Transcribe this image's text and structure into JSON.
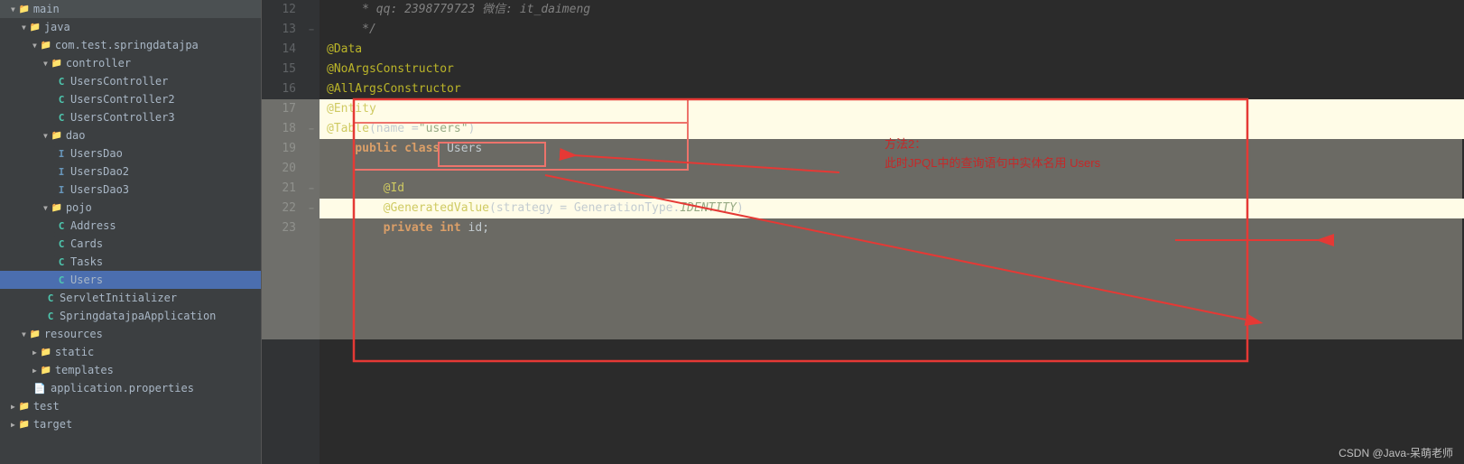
{
  "sidebar": {
    "items": [
      {
        "id": "main",
        "label": "main",
        "level": 0,
        "type": "folder-open",
        "expanded": true
      },
      {
        "id": "java",
        "label": "java",
        "level": 1,
        "type": "folder-open",
        "expanded": true
      },
      {
        "id": "com.test.springdatajpa",
        "label": "com.test.springdatajpa",
        "level": 2,
        "type": "folder-open",
        "expanded": true
      },
      {
        "id": "controller",
        "label": "controller",
        "level": 3,
        "type": "folder-open",
        "expanded": true
      },
      {
        "id": "UsersController",
        "label": "UsersController",
        "level": 4,
        "type": "class"
      },
      {
        "id": "UsersController2",
        "label": "UsersController2",
        "level": 4,
        "type": "class"
      },
      {
        "id": "UsersController3",
        "label": "UsersController3",
        "level": 4,
        "type": "class"
      },
      {
        "id": "dao",
        "label": "dao",
        "level": 3,
        "type": "folder-open",
        "expanded": true
      },
      {
        "id": "UsersDao",
        "label": "UsersDao",
        "level": 4,
        "type": "interface"
      },
      {
        "id": "UsersDao2",
        "label": "UsersDao2",
        "level": 4,
        "type": "interface"
      },
      {
        "id": "UsersDao3",
        "label": "UsersDao3",
        "level": 4,
        "type": "interface"
      },
      {
        "id": "pojo",
        "label": "pojo",
        "level": 3,
        "type": "folder-open",
        "expanded": true
      },
      {
        "id": "Address",
        "label": "Address",
        "level": 4,
        "type": "class"
      },
      {
        "id": "Cards",
        "label": "Cards",
        "level": 4,
        "type": "class"
      },
      {
        "id": "Tasks",
        "label": "Tasks",
        "level": 4,
        "type": "class"
      },
      {
        "id": "Users",
        "label": "Users",
        "level": 4,
        "type": "class",
        "selected": true
      },
      {
        "id": "ServletInitializer",
        "label": "ServletInitializer",
        "level": 3,
        "type": "class"
      },
      {
        "id": "SpringdatajpaApplication",
        "label": "SpringdatajpaApplication",
        "level": 3,
        "type": "class"
      },
      {
        "id": "resources",
        "label": "resources",
        "level": 1,
        "type": "folder-open",
        "expanded": true
      },
      {
        "id": "static",
        "label": "static",
        "level": 2,
        "type": "folder"
      },
      {
        "id": "templates",
        "label": "templates",
        "level": 2,
        "type": "folder"
      },
      {
        "id": "application.properties",
        "label": "application.properties",
        "level": 2,
        "type": "file"
      },
      {
        "id": "test",
        "label": "test",
        "level": 0,
        "type": "folder-open"
      },
      {
        "id": "target",
        "label": "target",
        "level": 0,
        "type": "folder"
      }
    ]
  },
  "editor": {
    "lines": [
      {
        "num": 12,
        "content": "comment_qq",
        "fold": ""
      },
      {
        "num": 13,
        "content": "comment_end",
        "fold": "fold"
      },
      {
        "num": 14,
        "content": "annotation_data",
        "fold": ""
      },
      {
        "num": 15,
        "content": "annotation_noargs",
        "fold": ""
      },
      {
        "num": 16,
        "content": "annotation_allargs",
        "fold": ""
      },
      {
        "num": 17,
        "content": "annotation_entity",
        "fold": ""
      },
      {
        "num": 18,
        "content": "annotation_table",
        "fold": "fold"
      },
      {
        "num": 19,
        "content": "class_declaration",
        "fold": ""
      },
      {
        "num": 20,
        "content": "empty",
        "fold": ""
      },
      {
        "num": 21,
        "content": "annotation_id",
        "fold": "fold"
      },
      {
        "num": 22,
        "content": "annotation_generated",
        "fold": "fold"
      },
      {
        "num": 23,
        "content": "private_int",
        "fold": ""
      }
    ]
  },
  "callout": {
    "method2": "方法2：",
    "description": "此时JPQL中的查询语句中实体名用 Users"
  },
  "watermark": "CSDN @Java-呆萌老师"
}
